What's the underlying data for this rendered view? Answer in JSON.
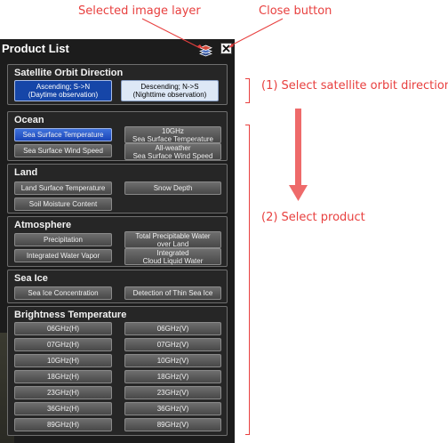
{
  "annotations": {
    "selected_layer": "Selected image layer",
    "close_button": "Close button",
    "step1": "(1) Select satellite orbit direction",
    "step2": "(2) Select product"
  },
  "panel": {
    "title": "Product List"
  },
  "orbit": {
    "title": "Satellite Orbit Direction",
    "ascending": "Ascending; S->N\n(Daytime observation)",
    "descending": "Descending; N->S\n(Nighttime observation)"
  },
  "ocean": {
    "title": "Ocean",
    "sst": "Sea Surface Temperature",
    "sst10": "10GHz\nSea Surface Temperature",
    "wind": "Sea Surface Wind Speed",
    "allwind": "All-weather\nSea Surface Wind Speed"
  },
  "land": {
    "title": "Land",
    "lst": "Land Surface Temperature",
    "snow": "Snow Depth",
    "soil": "Soil Moisture Content"
  },
  "atmosphere": {
    "title": "Atmosphere",
    "precip": "Precipitation",
    "tpw": "Total Precipitable Water\nover Land",
    "iwv": "Integrated Water Vapor",
    "clw": "Integrated\nCloud Liquid Water"
  },
  "seaice": {
    "title": "Sea Ice",
    "conc": "Sea Ice Concentration",
    "thin": "Detection of Thin Sea Ice"
  },
  "brightness": {
    "title": "Brightness Temperature",
    "h": [
      "06GHz(H)",
      "07GHz(H)",
      "10GHz(H)",
      "18GHz(H)",
      "23GHz(H)",
      "36GHz(H)",
      "89GHz(H)"
    ],
    "v": [
      "06GHz(V)",
      "07GHz(V)",
      "10GHz(V)",
      "18GHz(V)",
      "23GHz(V)",
      "36GHz(V)",
      "89GHz(V)"
    ]
  },
  "colors": {
    "annotation": "#e8403f",
    "active_button": "#1a45b8",
    "panel_background": "#1c1c1c"
  }
}
